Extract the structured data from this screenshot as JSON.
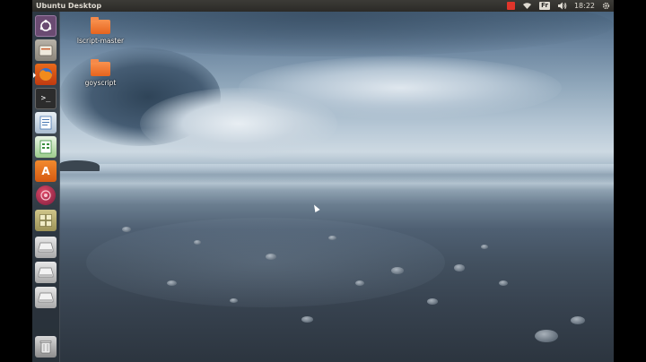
{
  "top_panel": {
    "title": "Ubuntu Desktop",
    "keyboard_layout": "Fr",
    "clock": "18:22"
  },
  "desktop": {
    "icons": [
      {
        "label": "lscript-master"
      },
      {
        "label": "goyscript"
      }
    ]
  },
  "launcher": {
    "items": [
      {
        "name": "Search your computer",
        "icon": "ubuntu-dash-icon"
      },
      {
        "name": "Files",
        "icon": "files-icon"
      },
      {
        "name": "Firefox Web Browser",
        "icon": "firefox-icon"
      },
      {
        "name": "Terminal",
        "icon": "terminal-icon",
        "glyph": ">_"
      },
      {
        "name": "LibreOffice Writer",
        "icon": "writer-icon"
      },
      {
        "name": "LibreOffice Calc",
        "icon": "calc-icon"
      },
      {
        "name": "Ubuntu Software Center",
        "icon": "software-center-icon",
        "glyph": "A"
      },
      {
        "name": "Help",
        "icon": "help-icon"
      },
      {
        "name": "Workspace Switcher",
        "icon": "workspace-switcher-icon"
      },
      {
        "name": "Drive 1",
        "icon": "drive-icon"
      },
      {
        "name": "Drive 2",
        "icon": "drive-icon"
      },
      {
        "name": "Drive 3",
        "icon": "drive-icon"
      },
      {
        "name": "Trash",
        "icon": "trash-icon"
      }
    ]
  },
  "colors": {
    "panel": "#3c3b37",
    "launcher": "#283038",
    "folder": "#f9924f",
    "indicator_red": "#e0352b"
  }
}
